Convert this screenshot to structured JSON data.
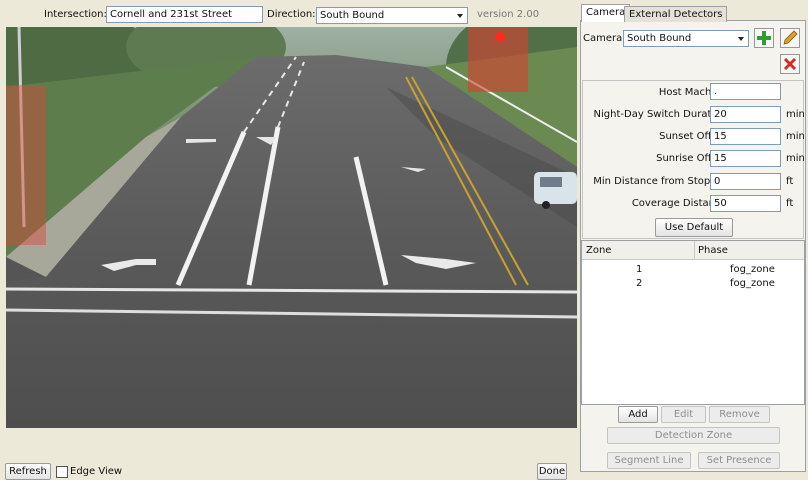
{
  "top": {
    "intersection_label": "Intersection:",
    "intersection_value": "Cornell and 231st Street",
    "direction_label": "Direction:",
    "direction_value": "South Bound",
    "version": "version 2.00"
  },
  "tabs": [
    "Camera",
    "External Detectors"
  ],
  "camera": {
    "label": "Camera:",
    "value": "South Bound"
  },
  "settings": {
    "host_label": "Host Machine:",
    "host_value": ".",
    "nds_label": "Night-Day Switch Duration:",
    "nds_value": "20",
    "nds_unit": "min",
    "sunset_label": "Sunset Offset:",
    "sunset_value": "15",
    "sunset_unit": "min",
    "sunrise_label": "Sunrise Offset:",
    "sunrise_value": "15",
    "sunrise_unit": "min",
    "mindist_label": "Min Distance from Stopbar:",
    "mindist_value": "0",
    "mindist_unit": "ft",
    "coverage_label": "Coverage Distance:",
    "coverage_value": "50",
    "coverage_unit": "ft",
    "use_default": "Use Default"
  },
  "zone_table": {
    "headers": [
      "Zone",
      "Phase"
    ],
    "rows": [
      {
        "zone": "1",
        "phase": "fog_zone"
      },
      {
        "zone": "2",
        "phase": "fog_zone"
      }
    ]
  },
  "zone_buttons": {
    "add": "Add",
    "edit": "Edit",
    "remove": "Remove",
    "detection_zone": "Detection Zone",
    "segment_line": "Segment Line",
    "set_presence": "Set Presence"
  },
  "bottom": {
    "refresh": "Refresh",
    "edge_view": "Edge View",
    "done": "Done"
  },
  "colors": {
    "add_icon": "#2e9e2e",
    "edit_icon": "#e0a020",
    "delete_icon": "#d03020"
  }
}
